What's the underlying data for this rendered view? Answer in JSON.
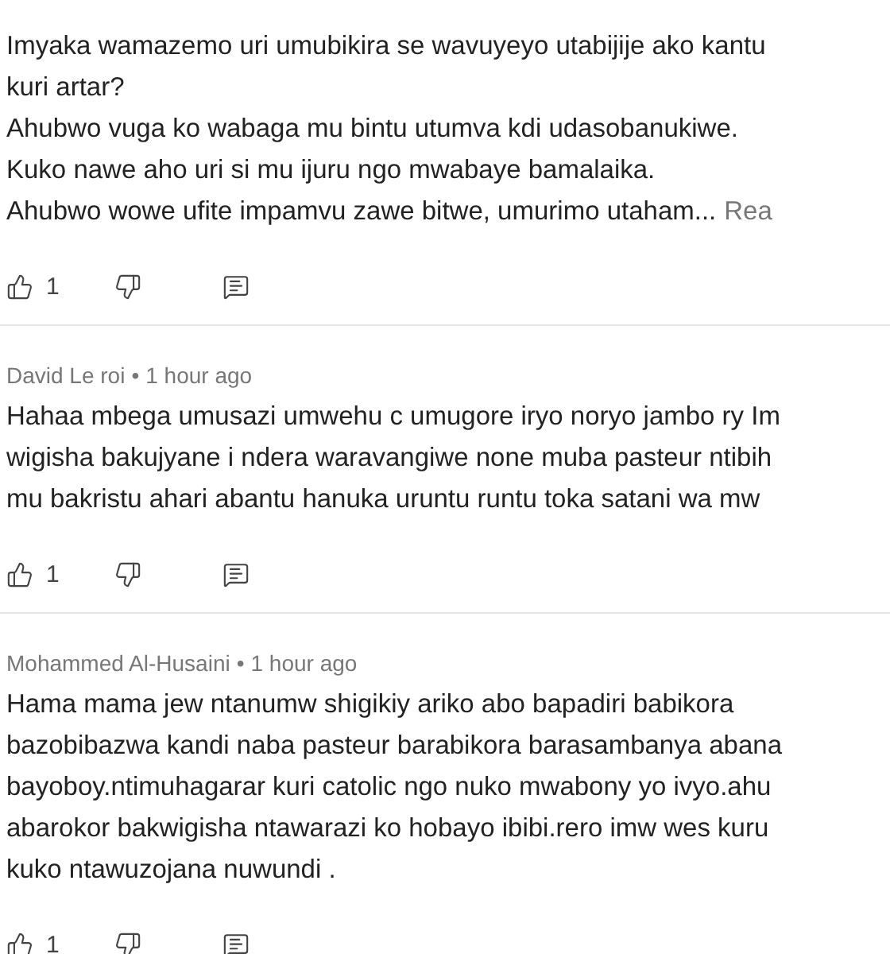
{
  "comments": [
    {
      "lines": [
        "Imyaka wamazemo uri umubikira se wavuyeyo utabijije ako kantu",
        "kuri artar?",
        "Ahubwo vuga ko wabaga mu bintu utumva kdi udasobanukiwe.",
        "Kuko nawe aho uri si mu ijuru ngo mwabaye bamalaika.",
        "Ahubwo wowe ufite impamvu zawe bitwe, umurimo utaham..."
      ],
      "read_more": "Rea",
      "likes": "1"
    },
    {
      "author": "David Le roi",
      "separator": "•",
      "time": "1 hour ago",
      "lines": [
        "Hahaa mbega umusazi umwehu c umugore iryo noryo jambo ry Im",
        "wigisha bakujyane i ndera waravangiwe none muba pasteur ntibih",
        "mu bakristu ahari abantu hanuka uruntu runtu toka satani wa mw"
      ],
      "likes": "1"
    },
    {
      "author": "Mohammed Al-Husaini",
      "separator": "•",
      "time": "1 hour ago",
      "lines": [
        "Hama mama jew ntanumw shigikiy ariko abo bapadiri babikora",
        "bazobibazwa kandi naba pasteur barabikora barasambanya abana",
        "bayoboy.ntimuhagarar kuri catolic ngo nuko mwabony yo ivyo.ahu",
        "abarokor bakwigisha ntawarazi ko hobayo ibibi.rero imw wes kuru",
        "kuko ntawuzojana nuwundi ."
      ],
      "likes": "1"
    }
  ]
}
